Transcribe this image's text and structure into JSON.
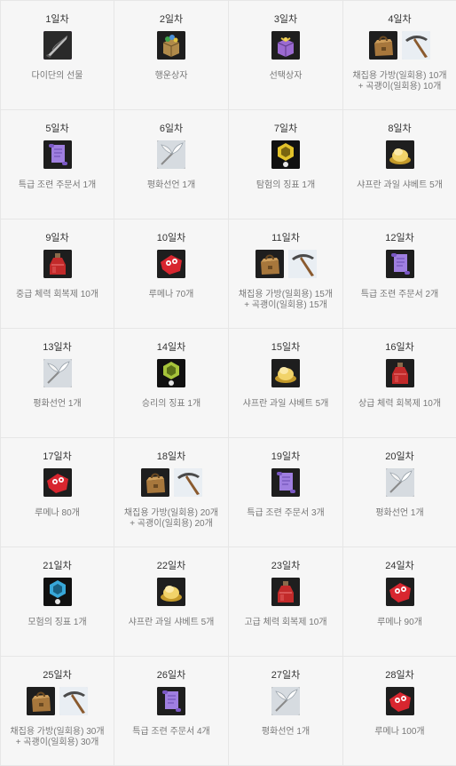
{
  "rewards": [
    {
      "day": "1일차",
      "items": [
        "dagger-icon"
      ],
      "text": "다이단의 선물"
    },
    {
      "day": "2일차",
      "items": [
        "lucky-box-icon"
      ],
      "text": "행운상자"
    },
    {
      "day": "3일차",
      "items": [
        "choice-box-icon"
      ],
      "text": "선택상자"
    },
    {
      "day": "4일차",
      "items": [
        "gathering-bag-icon",
        "pickaxe-icon"
      ],
      "text": "채집용 가방(일회용) 10개\n+ 곡괭이(일회용) 10개"
    },
    {
      "day": "5일차",
      "items": [
        "scroll-icon"
      ],
      "text": "특급 조련 주문서 1개"
    },
    {
      "day": "6일차",
      "items": [
        "peace-declaration-icon"
      ],
      "text": "평화선언 1개"
    },
    {
      "day": "7일차",
      "items": [
        "exploration-token-icon"
      ],
      "text": "탐험의 징표 1개"
    },
    {
      "day": "8일차",
      "items": [
        "sherbet-icon"
      ],
      "text": "샤프란 과일 샤베트 5개"
    },
    {
      "day": "9일차",
      "items": [
        "potion-icon"
      ],
      "text": "중급 체력 회복제 10개"
    },
    {
      "day": "10일차",
      "items": [
        "lumena-icon"
      ],
      "text": "루메나 70개"
    },
    {
      "day": "11일차",
      "items": [
        "gathering-bag-icon",
        "pickaxe-icon"
      ],
      "text": "채집용 가방(일회용) 15개\n+ 곡괭이(일회용) 15개"
    },
    {
      "day": "12일차",
      "items": [
        "scroll-icon"
      ],
      "text": "특급 조련 주문서 2개"
    },
    {
      "day": "13일차",
      "items": [
        "peace-declaration-icon"
      ],
      "text": "평화선언 1개"
    },
    {
      "day": "14일차",
      "items": [
        "victory-token-icon"
      ],
      "text": "승리의 징표 1개"
    },
    {
      "day": "15일차",
      "items": [
        "sherbet-icon"
      ],
      "text": "샤프란 과일 샤베트 5개"
    },
    {
      "day": "16일차",
      "items": [
        "potion-icon"
      ],
      "text": "상급 체력 회복제 10개"
    },
    {
      "day": "17일차",
      "items": [
        "lumena-icon"
      ],
      "text": "루메나 80개"
    },
    {
      "day": "18일차",
      "items": [
        "gathering-bag-icon",
        "pickaxe-icon"
      ],
      "text": "채집용 가방(일회용) 20개\n+ 곡괭이(일회용) 20개"
    },
    {
      "day": "19일차",
      "items": [
        "scroll-icon"
      ],
      "text": "특급 조련 주문서 3개"
    },
    {
      "day": "20일차",
      "items": [
        "peace-declaration-icon"
      ],
      "text": "평화선언 1개"
    },
    {
      "day": "21일차",
      "items": [
        "adventure-token-icon"
      ],
      "text": "모험의 징표 1개"
    },
    {
      "day": "22일차",
      "items": [
        "sherbet-icon"
      ],
      "text": "샤프란 과일 샤베트 5개"
    },
    {
      "day": "23일차",
      "items": [
        "potion-icon"
      ],
      "text": "고급 체력 회복제 10개"
    },
    {
      "day": "24일차",
      "items": [
        "lumena-icon"
      ],
      "text": "루메나 90개"
    },
    {
      "day": "25일차",
      "items": [
        "gathering-bag-icon",
        "pickaxe-icon"
      ],
      "text": "채집용 가방(일회용) 30개\n+ 곡괭이(일회용) 30개"
    },
    {
      "day": "26일차",
      "items": [
        "scroll-icon"
      ],
      "text": "특급 조련 주문서 4개"
    },
    {
      "day": "27일차",
      "items": [
        "peace-declaration-icon"
      ],
      "text": "평화선언 1개"
    },
    {
      "day": "28일차",
      "items": [
        "lumena-icon"
      ],
      "text": "루메나 100개"
    }
  ],
  "colors": {
    "cell_background": "#f6f6f6",
    "border": "#e6e6e6",
    "day_text": "#333333",
    "desc_text": "#777777"
  }
}
